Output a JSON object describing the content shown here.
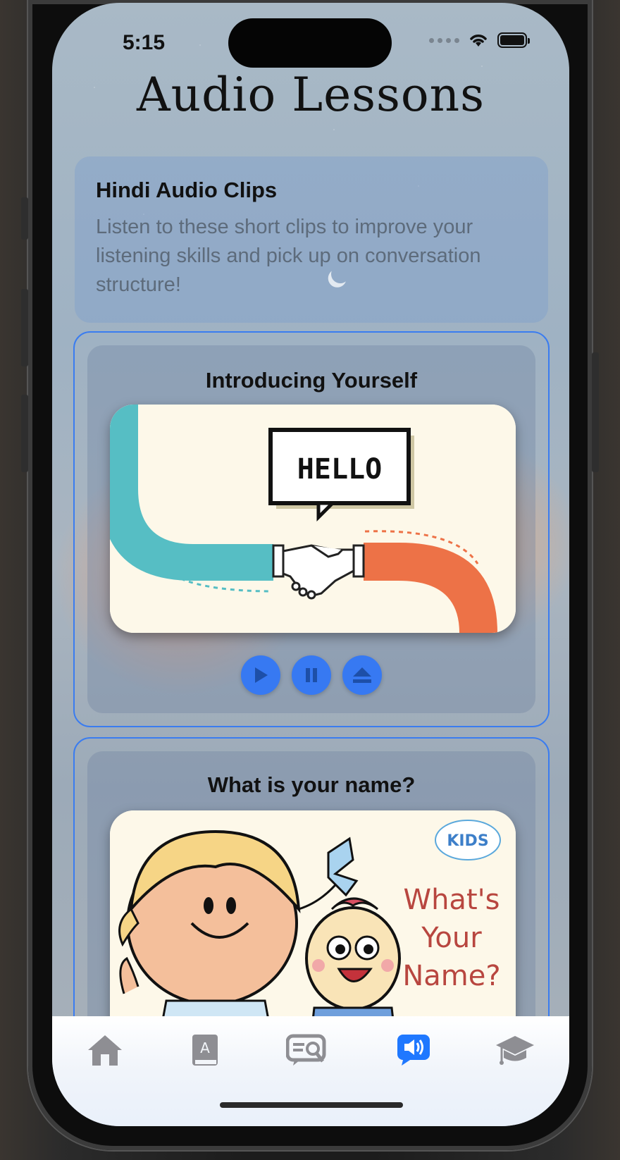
{
  "status": {
    "time": "5:15"
  },
  "page": {
    "title": "Audio Lessons"
  },
  "intro": {
    "title": "Hindi Audio Clips",
    "description": "Listen to these short clips to improve your listening skills and pick up on conversation structure!"
  },
  "lessons": [
    {
      "title": "Introducing Yourself",
      "image_text": "HELLO",
      "controls": [
        "play-icon",
        "pause-icon",
        "eject-icon"
      ]
    },
    {
      "title": "What is your name?",
      "image_text": "What's Your Name?",
      "logo_text": "KIDS"
    }
  ],
  "tab_bar": {
    "items": [
      "home-icon",
      "dictionary-icon",
      "search-chat-icon",
      "audio-lessons-icon",
      "graduation-cap-icon"
    ],
    "active_index": 3,
    "active_color": "#1f78ff",
    "inactive_color": "#8e8e93"
  }
}
